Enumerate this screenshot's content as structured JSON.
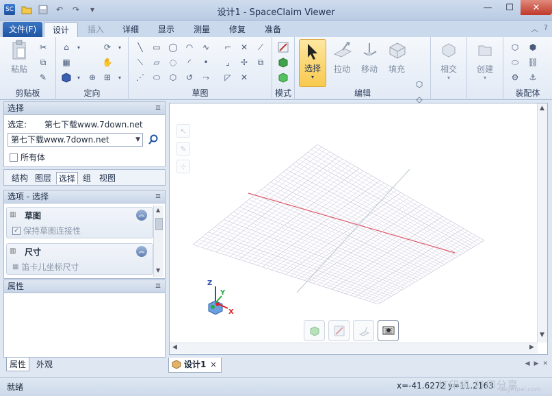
{
  "titlebar": {
    "title": "设计1 - SpaceClaim Viewer"
  },
  "ribbon_tabs": [
    "文件(F)",
    "设计",
    "插入",
    "详细",
    "显示",
    "测量",
    "修复",
    "准备"
  ],
  "ribbon": {
    "clipboard": {
      "label": "剪贴板",
      "paste": "粘贴"
    },
    "orient": {
      "label": "定向"
    },
    "sketch": {
      "label": "草图"
    },
    "mode": {
      "label": "模式"
    },
    "edit": {
      "label": "编辑",
      "select": "选择",
      "pull": "拉动",
      "move": "移动",
      "fill": "填充"
    },
    "intersect": {
      "label": "相交"
    },
    "create": {
      "label": "创建"
    },
    "assembly": {
      "label": "装配体"
    }
  },
  "select_panel": {
    "header": "选择",
    "selected_label": "选定:",
    "selected_value": "第七下载www.7down.net",
    "combo_value": "第七下载www.7down.net",
    "all_bodies": "所有体"
  },
  "structure_tabs": [
    "结构",
    "图层",
    "选择",
    "组",
    "视图"
  ],
  "options_panel": {
    "header": "选项 - 选择",
    "sections": [
      {
        "title": "草图",
        "item": "保持草图连接性"
      },
      {
        "title": "尺寸",
        "item": "笛卡儿坐标尺寸"
      }
    ]
  },
  "properties_panel": {
    "header": "属性"
  },
  "bottom_tabs": [
    "属性",
    "外观"
  ],
  "document_tab": {
    "label": "设计1"
  },
  "axes": {
    "x": "X",
    "y": "Y",
    "z": "Z"
  },
  "status": {
    "ready": "就绪",
    "coords": "x=-41.6272  y=11.2163",
    "watermark": "打印机 打印分享",
    "watermark_url": "dayinpai.com"
  },
  "colors": {
    "accent": "#1f55a3",
    "grid": "#d6d2e2",
    "axis_red": "#e05a6a",
    "select_highlight": "#f8c94d"
  }
}
